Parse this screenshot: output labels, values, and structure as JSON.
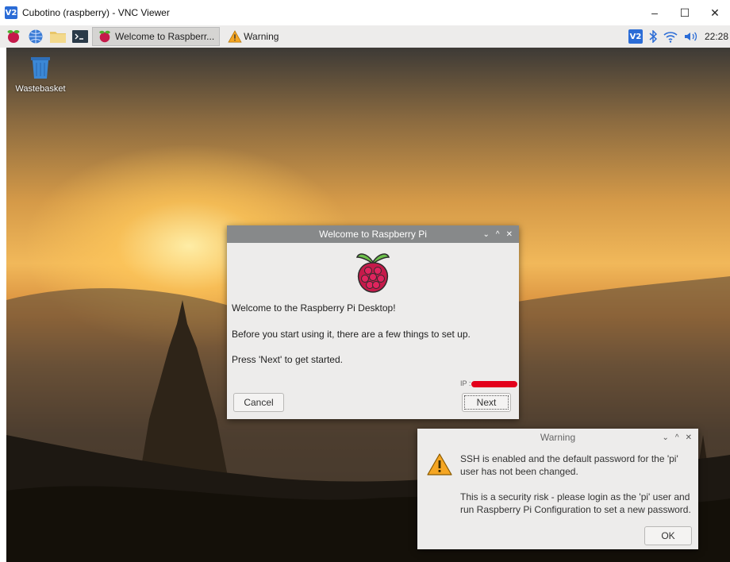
{
  "window": {
    "logo_text": "V2",
    "title": "Cubotino (raspberry) - VNC Viewer",
    "controls": [
      "–",
      "☐",
      "✕"
    ]
  },
  "taskbar": {
    "tasks": [
      {
        "label": "Welcome to Raspberr...",
        "icon": "raspberry-icon",
        "active": true
      },
      {
        "label": "Warning",
        "icon": "warning-icon",
        "active": false
      }
    ],
    "tray": {
      "vnc_label": "V2",
      "clock": "22:28"
    }
  },
  "desktop": {
    "icons": [
      {
        "label": "Wastebasket",
        "icon": "wastebasket-icon"
      }
    ]
  },
  "welcome_dialog": {
    "title": "Welcome to Raspberry Pi",
    "title_buttons": [
      "⌄",
      "^",
      "✕"
    ],
    "line1": "Welcome to the Raspberry Pi Desktop!",
    "line2": "Before you start using it, there are a few things to set up.",
    "line3": "Press 'Next' to get started.",
    "ip_label": "IP :",
    "cancel_label": "Cancel",
    "next_label": "Next"
  },
  "warning_dialog": {
    "title": "Warning",
    "title_buttons": [
      "⌄",
      "^",
      "✕"
    ],
    "message1": "SSH is enabled and the default password for the 'pi' user has not been changed.",
    "message2": "This is a security risk - please login as the 'pi' user and run Raspberry Pi Configuration to set a new password.",
    "ok_label": "OK"
  },
  "colors": {
    "accent": "#2b6cd6",
    "dialog_title": "#87898a",
    "redaction": "#e3001b",
    "warning": "#f5a623"
  }
}
